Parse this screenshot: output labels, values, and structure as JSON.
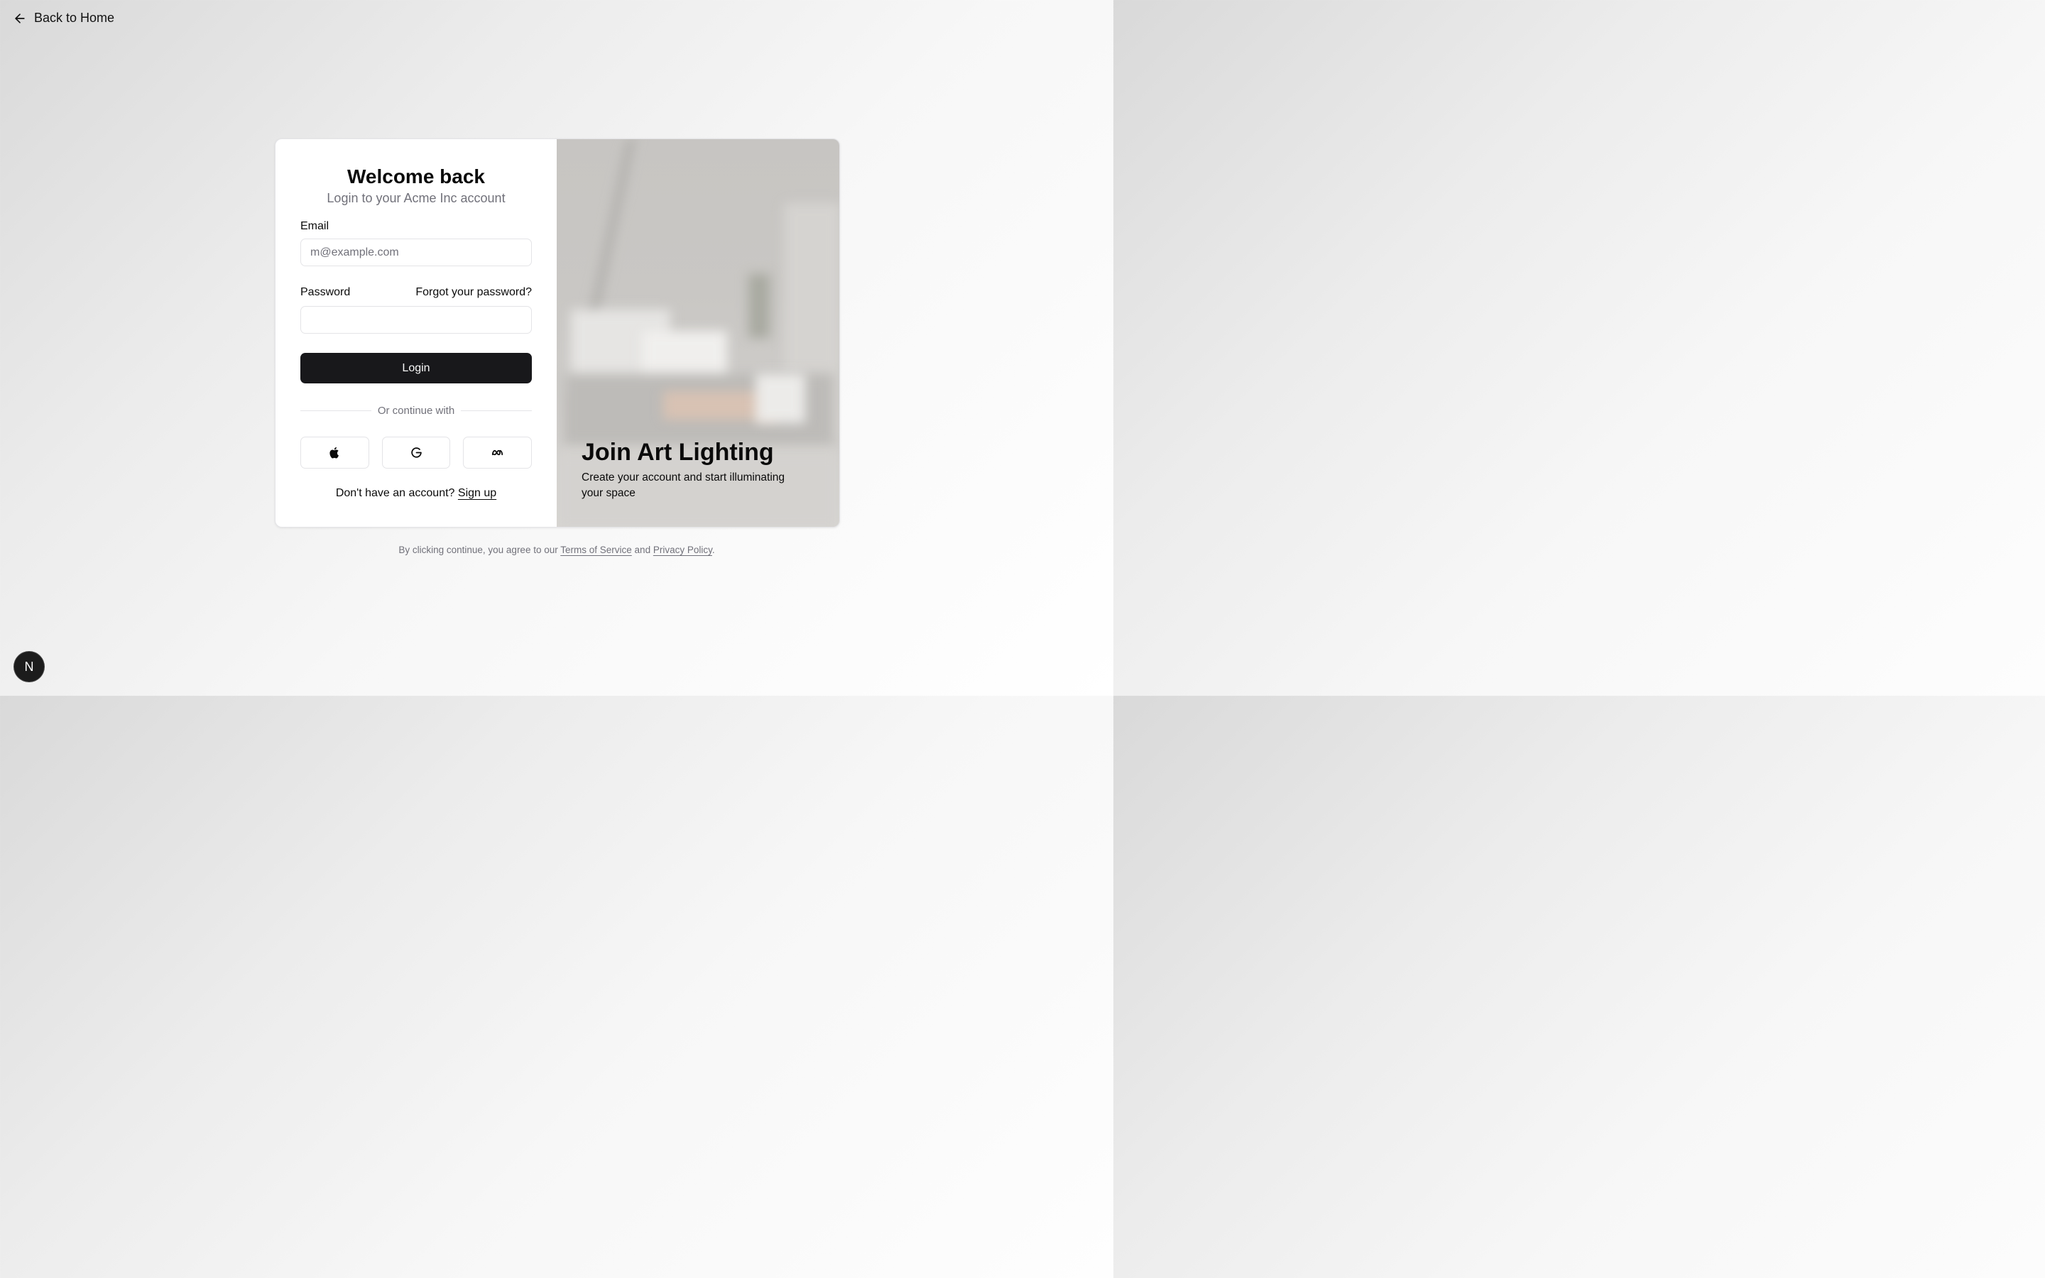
{
  "nav": {
    "back_label": "Back to Home"
  },
  "form": {
    "title": "Welcome back",
    "subtitle": "Login to your Acme Inc account",
    "email_label": "Email",
    "email_placeholder": "m@example.com",
    "email_value": "",
    "password_label": "Password",
    "forgot_label": "Forgot your password?",
    "password_value": "",
    "login_label": "Login",
    "divider_text": "Or continue with",
    "social": [
      {
        "icon": "apple-icon"
      },
      {
        "icon": "google-icon"
      },
      {
        "icon": "meta-icon"
      }
    ],
    "signup_prompt": "Don't have an account?",
    "signup_label": "Sign up"
  },
  "promo": {
    "title": "Join Art Lighting",
    "subtitle": "Create your account and start illuminating your space"
  },
  "legal": {
    "prefix": "By clicking continue, you agree to our",
    "terms": "Terms of Service",
    "and": "and",
    "privacy": "Privacy Policy",
    "suffix": "."
  },
  "badge": {
    "letter": "N"
  },
  "colors": {
    "primary": "#18181b",
    "muted_text": "#71717a",
    "border": "#e4e4e7"
  }
}
